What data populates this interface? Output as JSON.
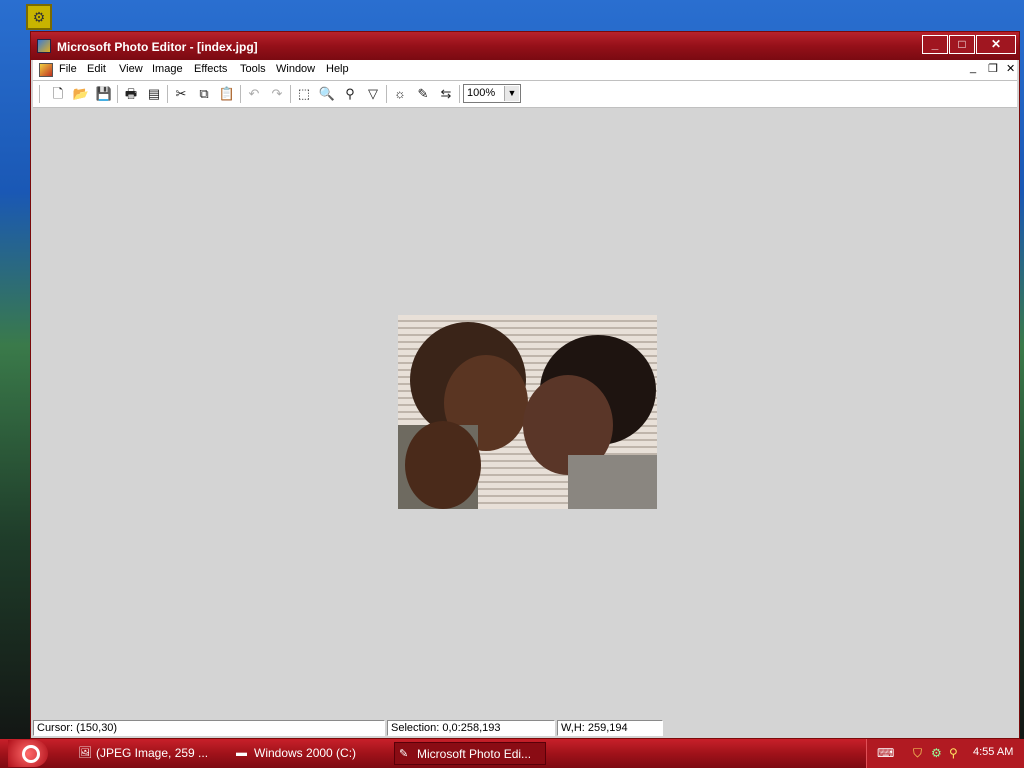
{
  "window": {
    "title": "Microsoft Photo Editor - [index.jpg]",
    "controls": {
      "minimize": "_",
      "maximize": "□",
      "close": "✕"
    }
  },
  "menu": {
    "items": [
      "File",
      "Edit",
      "View",
      "Image",
      "Effects",
      "Tools",
      "Window",
      "Help"
    ],
    "doc_controls": {
      "minimize": "_",
      "restore": "❐",
      "close": "✕"
    }
  },
  "toolbar": {
    "zoom": {
      "value": "100%"
    },
    "icons": [
      "new-icon",
      "open-icon",
      "save-icon",
      "print-icon",
      "scan-icon",
      "cut-icon",
      "copy-icon",
      "paste-icon",
      "undo-icon",
      "redo-icon",
      "select-icon",
      "zoom-icon",
      "pen-icon",
      "triangle-icon",
      "sun-icon",
      "brush-icon",
      "transform-icon"
    ]
  },
  "status": {
    "cursor": "Cursor: (150,30)",
    "selection": "Selection: 0,0:258,193",
    "size": "W,H: 259,194"
  },
  "taskbar": {
    "tasks": [
      {
        "label": "(JPEG Image, 259 ...",
        "active": false
      },
      {
        "label": "Windows 2000 (C:)",
        "active": false
      },
      {
        "label": "Microsoft Photo Edi...",
        "active": true
      }
    ],
    "clock": "4:55 AM"
  }
}
